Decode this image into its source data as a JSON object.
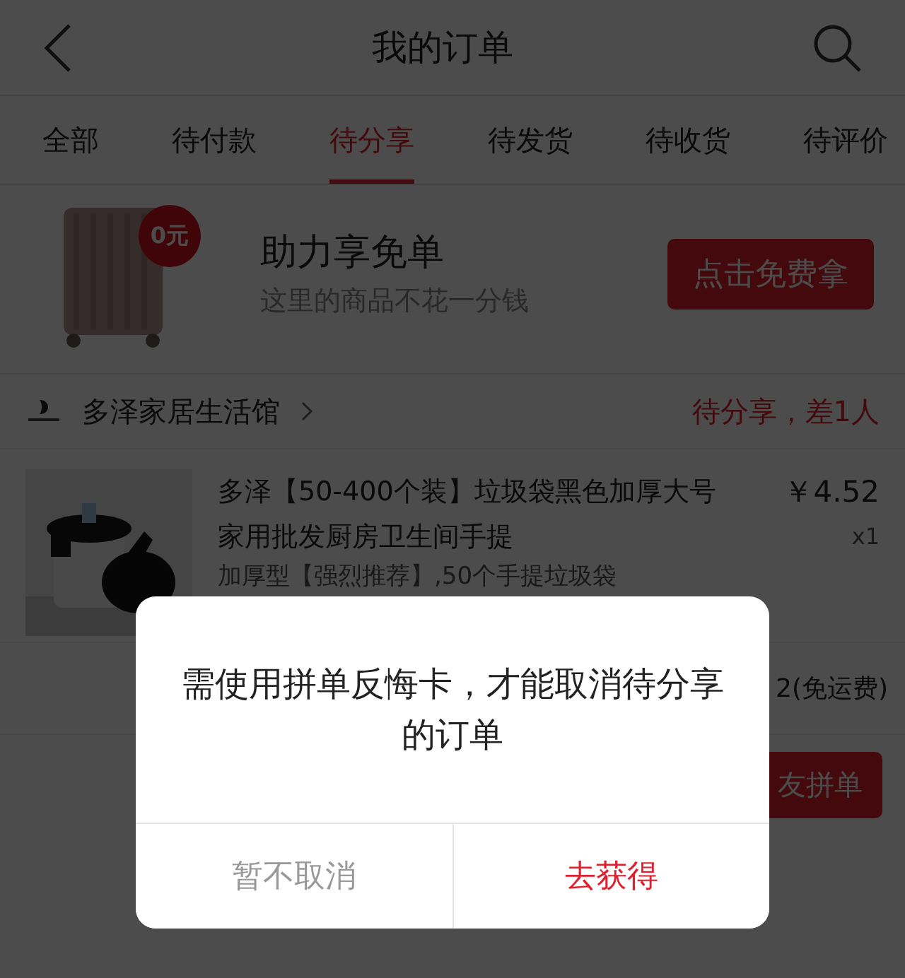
{
  "header": {
    "title": "我的订单"
  },
  "tabs": [
    {
      "label": "全部",
      "selected": false
    },
    {
      "label": "待付款",
      "selected": false
    },
    {
      "label": "待分享",
      "selected": true
    },
    {
      "label": "待发货",
      "selected": false
    },
    {
      "label": "待收货",
      "selected": false
    },
    {
      "label": "待评价",
      "selected": false
    }
  ],
  "banner": {
    "badge": "0元",
    "title": "助力享免单",
    "subtitle": "这里的商品不花一分钱",
    "button": "点击免费拿"
  },
  "store": {
    "name": "多泽家居生活馆",
    "status": "待分享，差1人"
  },
  "product": {
    "title": "多泽【50-400个装】垃圾袋黑色加厚大号家用批发厨房卫生间手提",
    "price": "￥4.52",
    "quantity": "x1",
    "variant": "加厚型【强烈推荐】,50个手提垃圾袋"
  },
  "order_total": {
    "shipping": "2(免运费)"
  },
  "order_action": {
    "button": "友拼单"
  },
  "dialog": {
    "message": "需使用拼单反悔卡，才能取消待分享的订单",
    "buttons": [
      {
        "label": "暂不取消",
        "kind": "cancel"
      },
      {
        "label": "去获得",
        "kind": "confirm"
      }
    ]
  }
}
